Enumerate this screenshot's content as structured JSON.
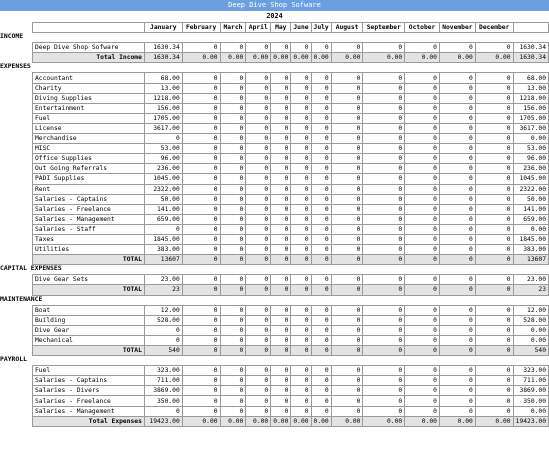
{
  "app_title": "Deep Dive Shop Sofware",
  "year": "2024",
  "months": [
    "January",
    "February",
    "March",
    "April",
    "May",
    "June",
    "July",
    "August",
    "September",
    "October",
    "November",
    "December"
  ],
  "sections": [
    {
      "title": "INCOME",
      "rows": [
        {
          "label": "Deep Dive Shop Sofware",
          "values": [
            "1630.34",
            "0",
            "0",
            "0",
            "0",
            "0",
            "0",
            "0",
            "0",
            "0",
            "0",
            "0"
          ],
          "total": "1630.34"
        }
      ],
      "total_row": {
        "label": "Total Income",
        "values": [
          "1630.34",
          "0.00",
          "0.00",
          "0.00",
          "0.00",
          "0.00",
          "0.00",
          "0.00",
          "0.00",
          "0.00",
          "0.00",
          "0.00"
        ],
        "total": "1630.34"
      }
    },
    {
      "title": "EXPENSES",
      "rows": [
        {
          "label": "Accountant",
          "values": [
            "68.00",
            "0",
            "0",
            "0",
            "0",
            "0",
            "0",
            "0",
            "0",
            "0",
            "0",
            "0"
          ],
          "total": "68.00"
        },
        {
          "label": "Charity",
          "values": [
            "13.00",
            "0",
            "0",
            "0",
            "0",
            "0",
            "0",
            "0",
            "0",
            "0",
            "0",
            "0"
          ],
          "total": "13.00"
        },
        {
          "label": "Diving Supplies",
          "values": [
            "1218.00",
            "0",
            "0",
            "0",
            "0",
            "0",
            "0",
            "0",
            "0",
            "0",
            "0",
            "0"
          ],
          "total": "1218.00"
        },
        {
          "label": "Entertainment",
          "values": [
            "156.00",
            "0",
            "0",
            "0",
            "0",
            "0",
            "0",
            "0",
            "0",
            "0",
            "0",
            "0"
          ],
          "total": "156.00"
        },
        {
          "label": "Fuel",
          "values": [
            "1705.00",
            "0",
            "0",
            "0",
            "0",
            "0",
            "0",
            "0",
            "0",
            "0",
            "0",
            "0"
          ],
          "total": "1705.00"
        },
        {
          "label": "License",
          "values": [
            "3617.00",
            "0",
            "0",
            "0",
            "0",
            "0",
            "0",
            "0",
            "0",
            "0",
            "0",
            "0"
          ],
          "total": "3617.00"
        },
        {
          "label": "Merchandise",
          "values": [
            "0",
            "0",
            "0",
            "0",
            "0",
            "0",
            "0",
            "0",
            "0",
            "0",
            "0",
            "0"
          ],
          "total": "0.00"
        },
        {
          "label": "MISC",
          "values": [
            "53.00",
            "0",
            "0",
            "0",
            "0",
            "0",
            "0",
            "0",
            "0",
            "0",
            "0",
            "0"
          ],
          "total": "53.00"
        },
        {
          "label": "Office Supplies",
          "values": [
            "96.00",
            "0",
            "0",
            "0",
            "0",
            "0",
            "0",
            "0",
            "0",
            "0",
            "0",
            "0"
          ],
          "total": "96.00"
        },
        {
          "label": "Out Going Referrals",
          "values": [
            "236.00",
            "0",
            "0",
            "0",
            "0",
            "0",
            "0",
            "0",
            "0",
            "0",
            "0",
            "0"
          ],
          "total": "236.00"
        },
        {
          "label": "PADI Supplies",
          "values": [
            "1045.00",
            "0",
            "0",
            "0",
            "0",
            "0",
            "0",
            "0",
            "0",
            "0",
            "0",
            "0"
          ],
          "total": "1045.00"
        },
        {
          "label": "Rent",
          "values": [
            "2322.00",
            "0",
            "0",
            "0",
            "0",
            "0",
            "0",
            "0",
            "0",
            "0",
            "0",
            "0"
          ],
          "total": "2322.00"
        },
        {
          "label": "Salaries - Captains",
          "values": [
            "50.00",
            "0",
            "0",
            "0",
            "0",
            "0",
            "0",
            "0",
            "0",
            "0",
            "0",
            "0"
          ],
          "total": "50.00"
        },
        {
          "label": "Salaries - Freelance",
          "values": [
            "141.00",
            "0",
            "0",
            "0",
            "0",
            "0",
            "0",
            "0",
            "0",
            "0",
            "0",
            "0"
          ],
          "total": "141.00"
        },
        {
          "label": "Salaries - Management",
          "values": [
            "659.00",
            "0",
            "0",
            "0",
            "0",
            "0",
            "0",
            "0",
            "0",
            "0",
            "0",
            "0"
          ],
          "total": "659.00"
        },
        {
          "label": "Salaries - Staff",
          "values": [
            "0",
            "0",
            "0",
            "0",
            "0",
            "0",
            "0",
            "0",
            "0",
            "0",
            "0",
            "0"
          ],
          "total": "0.00"
        },
        {
          "label": "Taxes",
          "values": [
            "1845.00",
            "0",
            "0",
            "0",
            "0",
            "0",
            "0",
            "0",
            "0",
            "0",
            "0",
            "0"
          ],
          "total": "1845.00"
        },
        {
          "label": "Utilities",
          "values": [
            "383.00",
            "0",
            "0",
            "0",
            "0",
            "0",
            "0",
            "0",
            "0",
            "0",
            "0",
            "0"
          ],
          "total": "383.00"
        }
      ],
      "total_row": {
        "label": "TOTAL",
        "values": [
          "13607",
          "0",
          "0",
          "0",
          "0",
          "0",
          "0",
          "0",
          "0",
          "0",
          "0",
          "0"
        ],
        "total": "13607"
      }
    },
    {
      "title": "CAPITAL EXPENSES",
      "rows": [
        {
          "label": "Dive Gear Sets",
          "values": [
            "23.00",
            "0",
            "0",
            "0",
            "0",
            "0",
            "0",
            "0",
            "0",
            "0",
            "0",
            "0"
          ],
          "total": "23.00"
        }
      ],
      "total_row": {
        "label": "TOTAL",
        "values": [
          "23",
          "0",
          "0",
          "0",
          "0",
          "0",
          "0",
          "0",
          "0",
          "0",
          "0",
          "0"
        ],
        "total": "23"
      }
    },
    {
      "title": "MAINTENANCE",
      "rows": [
        {
          "label": "Boat",
          "values": [
            "12.00",
            "0",
            "0",
            "0",
            "0",
            "0",
            "0",
            "0",
            "0",
            "0",
            "0",
            "0"
          ],
          "total": "12.00"
        },
        {
          "label": "Building",
          "values": [
            "528.00",
            "0",
            "0",
            "0",
            "0",
            "0",
            "0",
            "0",
            "0",
            "0",
            "0",
            "0"
          ],
          "total": "528.00"
        },
        {
          "label": "Dive Gear",
          "values": [
            "0",
            "0",
            "0",
            "0",
            "0",
            "0",
            "0",
            "0",
            "0",
            "0",
            "0",
            "0"
          ],
          "total": "0.00"
        },
        {
          "label": "Mechanical",
          "values": [
            "0",
            "0",
            "0",
            "0",
            "0",
            "0",
            "0",
            "0",
            "0",
            "0",
            "0",
            "0"
          ],
          "total": "0.00"
        }
      ],
      "total_row": {
        "label": "TOTAL",
        "values": [
          "540",
          "0",
          "0",
          "0",
          "0",
          "0",
          "0",
          "0",
          "0",
          "0",
          "0",
          "0"
        ],
        "total": "540"
      }
    },
    {
      "title": "PAYROLL",
      "rows": [
        {
          "label": "Fuel",
          "values": [
            "323.00",
            "0",
            "0",
            "0",
            "0",
            "0",
            "0",
            "0",
            "0",
            "0",
            "0",
            "0"
          ],
          "total": "323.00"
        },
        {
          "label": "Salaries - Captains",
          "values": [
            "711.00",
            "0",
            "0",
            "0",
            "0",
            "0",
            "0",
            "0",
            "0",
            "0",
            "0",
            "0"
          ],
          "total": "711.00"
        },
        {
          "label": "Salaries - Divers",
          "values": [
            "3869.00",
            "0",
            "0",
            "0",
            "0",
            "0",
            "0",
            "0",
            "0",
            "0",
            "0",
            "0"
          ],
          "total": "3869.00"
        },
        {
          "label": "Salaries - Freelance",
          "values": [
            "350.00",
            "0",
            "0",
            "0",
            "0",
            "0",
            "0",
            "0",
            "0",
            "0",
            "0",
            "0"
          ],
          "total": "350.00"
        },
        {
          "label": "Salaries - Management",
          "values": [
            "0",
            "0",
            "0",
            "0",
            "0",
            "0",
            "0",
            "0",
            "0",
            "0",
            "0",
            "0"
          ],
          "total": "0.00"
        }
      ],
      "total_row": {
        "label": "Total Expenses",
        "values": [
          "19423.00",
          "0.00",
          "0.00",
          "0.00",
          "0.00",
          "0.00",
          "0.00",
          "0.00",
          "0.00",
          "0.00",
          "0.00",
          "0.00"
        ],
        "total": "19423.00"
      }
    }
  ]
}
